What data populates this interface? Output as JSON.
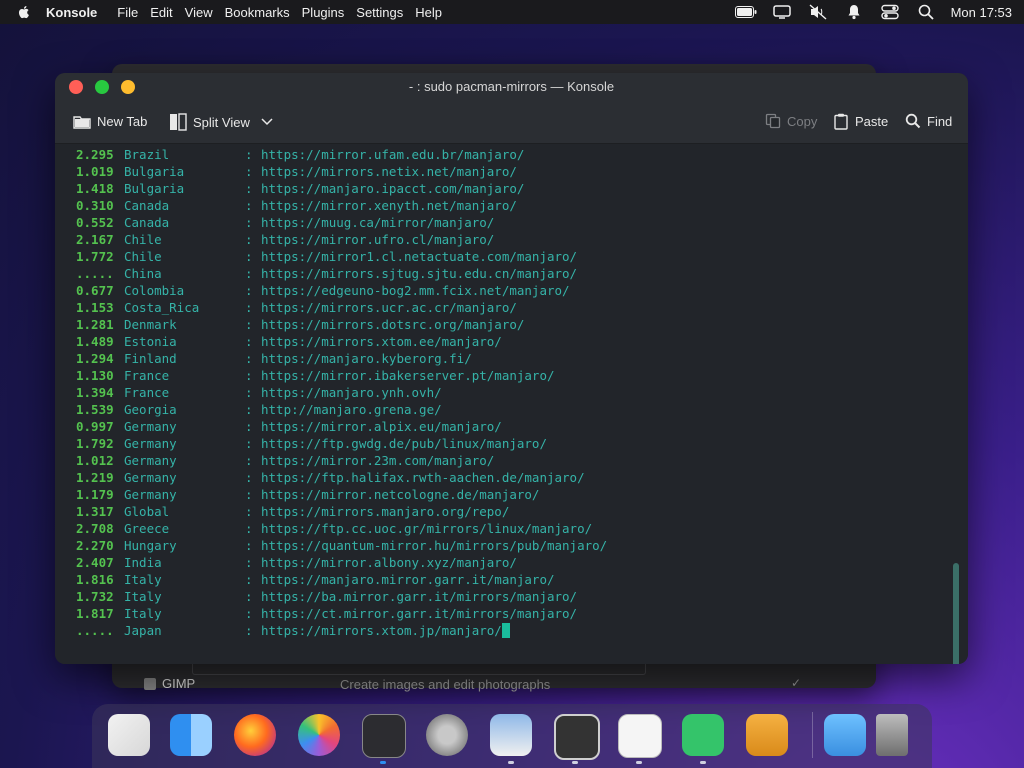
{
  "menubar": {
    "app_name": "Konsole",
    "menus": [
      "File",
      "Edit",
      "View",
      "Bookmarks",
      "Plugins",
      "Settings",
      "Help"
    ],
    "clock": "Mon 17:53",
    "status_icons": [
      "battery-icon",
      "screen-mirror-icon",
      "mute-icon",
      "notification-icon",
      "control-center-icon",
      "spotlight-search-icon"
    ]
  },
  "background_window": {
    "gimp_label": "GIMP",
    "gimp_description": "Create images and edit photographs",
    "check": "✓"
  },
  "window": {
    "title": "- : sudo pacman-mirrors — Konsole",
    "toolbar": {
      "new_tab": "New Tab",
      "split_view": "Split View",
      "copy": "Copy",
      "paste": "Paste",
      "find": "Find"
    }
  },
  "terminal": {
    "lines": [
      {
        "time": "2.295",
        "country": "Brazil",
        "sep": ":",
        "url": "https://mirror.ufam.edu.br/manjaro/"
      },
      {
        "time": "1.019",
        "country": "Bulgaria",
        "sep": ":",
        "url": "https://mirrors.netix.net/manjaro/"
      },
      {
        "time": "1.418",
        "country": "Bulgaria",
        "sep": ":",
        "url": "https://manjaro.ipacct.com/manjaro/"
      },
      {
        "time": "0.310",
        "country": "Canada",
        "sep": ":",
        "url": "https://mirror.xenyth.net/manjaro/"
      },
      {
        "time": "0.552",
        "country": "Canada",
        "sep": ":",
        "url": "https://muug.ca/mirror/manjaro/"
      },
      {
        "time": "2.167",
        "country": "Chile",
        "sep": ":",
        "url": "https://mirror.ufro.cl/manjaro/"
      },
      {
        "time": "1.772",
        "country": "Chile",
        "sep": ":",
        "url": "https://mirror1.cl.netactuate.com/manjaro/"
      },
      {
        "time": ".....",
        "country": "China",
        "sep": ":",
        "url": "https://mirrors.sjtug.sjtu.edu.cn/manjaro/"
      },
      {
        "time": "0.677",
        "country": "Colombia",
        "sep": ":",
        "url": "https://edgeuno-bog2.mm.fcix.net/manjaro/"
      },
      {
        "time": "1.153",
        "country": "Costa_Rica",
        "sep": ":",
        "url": "https://mirrors.ucr.ac.cr/manjaro/"
      },
      {
        "time": "1.281",
        "country": "Denmark",
        "sep": ":",
        "url": "https://mirrors.dotsrc.org/manjaro/"
      },
      {
        "time": "1.489",
        "country": "Estonia",
        "sep": ":",
        "url": "https://mirrors.xtom.ee/manjaro/"
      },
      {
        "time": "1.294",
        "country": "Finland",
        "sep": ":",
        "url": "https://manjaro.kyberorg.fi/"
      },
      {
        "time": "1.130",
        "country": "France",
        "sep": ":",
        "url": "https://mirror.ibakerserver.pt/manjaro/"
      },
      {
        "time": "1.394",
        "country": "France",
        "sep": ":",
        "url": "https://manjaro.ynh.ovh/"
      },
      {
        "time": "1.539",
        "country": "Georgia",
        "sep": ":",
        "url": "http://manjaro.grena.ge/"
      },
      {
        "time": "0.997",
        "country": "Germany",
        "sep": ":",
        "url": "https://mirror.alpix.eu/manjaro/"
      },
      {
        "time": "1.792",
        "country": "Germany",
        "sep": ":",
        "url": "https://ftp.gwdg.de/pub/linux/manjaro/"
      },
      {
        "time": "1.012",
        "country": "Germany",
        "sep": ":",
        "url": "https://mirror.23m.com/manjaro/"
      },
      {
        "time": "1.219",
        "country": "Germany",
        "sep": ":",
        "url": "https://ftp.halifax.rwth-aachen.de/manjaro/"
      },
      {
        "time": "1.179",
        "country": "Germany",
        "sep": ":",
        "url": "https://mirror.netcologne.de/manjaro/"
      },
      {
        "time": "1.317",
        "country": "Global",
        "sep": ":",
        "url": "https://mirrors.manjaro.org/repo/"
      },
      {
        "time": "2.708",
        "country": "Greece",
        "sep": ":",
        "url": "https://ftp.cc.uoc.gr/mirrors/linux/manjaro/"
      },
      {
        "time": "2.270",
        "country": "Hungary",
        "sep": ":",
        "url": "https://quantum-mirror.hu/mirrors/pub/manjaro/"
      },
      {
        "time": "2.407",
        "country": "India",
        "sep": ":",
        "url": "https://mirror.albony.xyz/manjaro/"
      },
      {
        "time": "1.816",
        "country": "Italy",
        "sep": ":",
        "url": "https://manjaro.mirror.garr.it/manjaro/"
      },
      {
        "time": "1.732",
        "country": "Italy",
        "sep": ":",
        "url": "https://ba.mirror.garr.it/mirrors/manjaro/"
      },
      {
        "time": "1.817",
        "country": "Italy",
        "sep": ":",
        "url": "https://ct.mirror.garr.it/mirrors/manjaro/"
      },
      {
        "time": ".....",
        "country": "Japan",
        "sep": ":",
        "url": "https://mirrors.xtom.jp/manjaro/"
      }
    ]
  },
  "dock": {
    "apps": [
      "launchpad-icon",
      "finder-icon",
      "firefox-icon",
      "photos-icon",
      "terminal-icon",
      "system-preferences-icon",
      "preview-icon",
      "cassette-player-icon",
      "textedit-icon",
      "manjaro-icon",
      "archive-utility-icon",
      "downloads-folder-icon",
      "trash-icon"
    ]
  },
  "colors": {
    "time_green": "#54c24f",
    "text_teal": "#35b3a8",
    "cursor": "#1abc9c",
    "terminal_bg": "#22252a"
  }
}
